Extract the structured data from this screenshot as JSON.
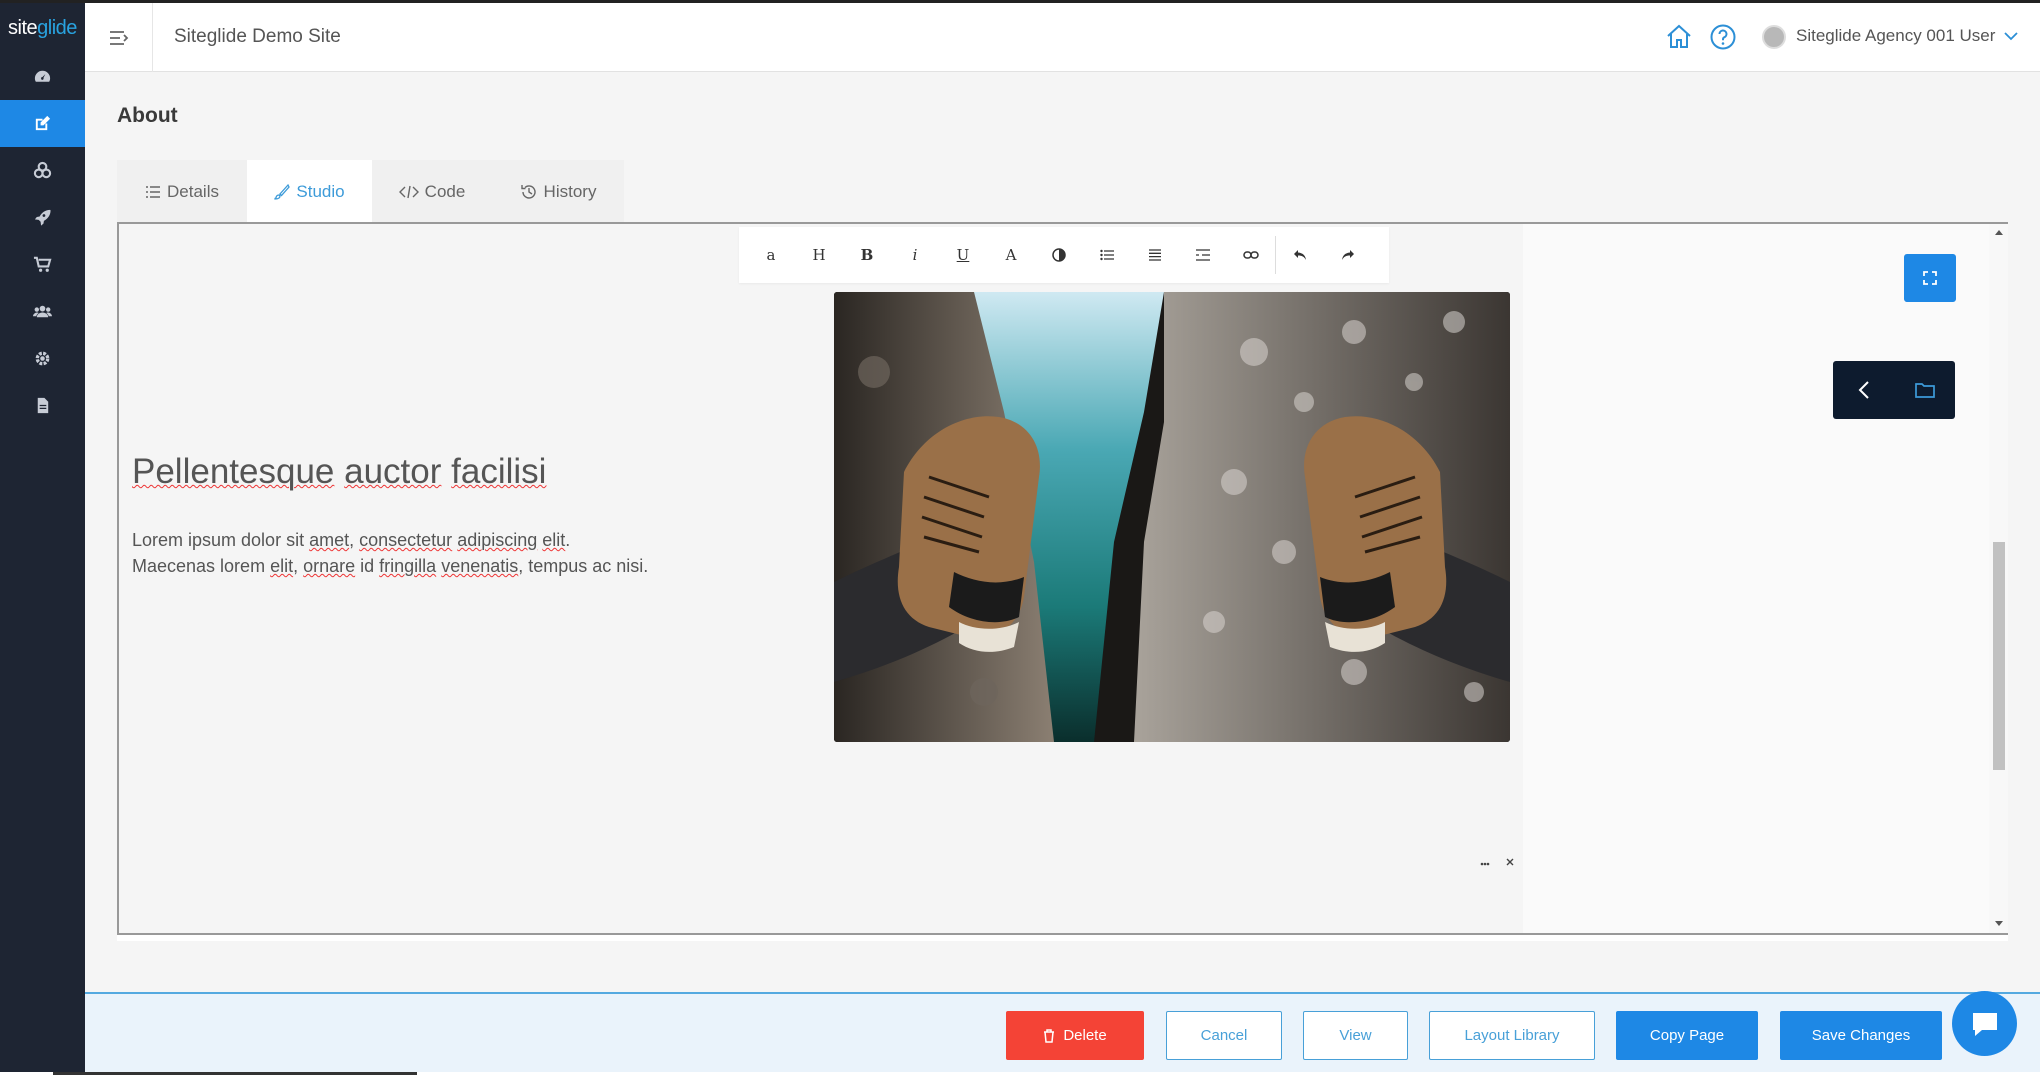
{
  "app": {
    "logo_text_1": "site",
    "logo_text_2": "glide",
    "site_title": "Siteglide Demo Site",
    "user_name": "Siteglide Agency 001 User"
  },
  "sidebar": {
    "items": [
      {
        "icon": "dashboard-icon",
        "active": false
      },
      {
        "icon": "edit-icon",
        "active": true
      },
      {
        "icon": "modules-icon",
        "active": false
      },
      {
        "icon": "rocket-icon",
        "active": false
      },
      {
        "icon": "cart-icon",
        "active": false
      },
      {
        "icon": "users-icon",
        "active": false
      },
      {
        "icon": "gear-icon",
        "active": false
      },
      {
        "icon": "document-icon",
        "active": false
      }
    ]
  },
  "page": {
    "title": "About"
  },
  "tabs": [
    {
      "label": "Details",
      "icon": "list-icon"
    },
    {
      "label": "Studio",
      "icon": "brush-icon",
      "active": true
    },
    {
      "label": "Code",
      "icon": "code-icon"
    },
    {
      "label": "History",
      "icon": "history-icon"
    }
  ],
  "toolbar": {
    "buttons": [
      "a",
      "H",
      "B",
      "i",
      "U",
      "A"
    ]
  },
  "content": {
    "heading_words": [
      "Pellentesque",
      "auctor",
      "facilisi"
    ],
    "para_line1_prefix": "Lorem ipsum dolor sit ",
    "para_amet": "amet",
    "para_comma1": ", ",
    "para_consectetur": "consectetur",
    "para_space1": " ",
    "para_adipiscing": "adipiscing",
    "para_space2": " ",
    "para_elit1": "elit",
    "para_period": ".",
    "para_line2_prefix": "Maecenas lorem ",
    "para_elit2": "elit",
    "para_comma2": ", ",
    "para_ornare": "ornare",
    "para_id": " id ",
    "para_fringilla": "fringilla",
    "para_space3": " ",
    "para_venenatis": "venenatis",
    "para_suffix": ", tempus ac nisi."
  },
  "footer": {
    "delete": "Delete",
    "cancel": "Cancel",
    "view": "View",
    "layout_library": "Layout Library",
    "copy_page": "Copy Page",
    "save_changes": "Save Changes"
  },
  "colors": {
    "accent": "#1e88e5",
    "sidebar": "#1e2533",
    "danger": "#f44336"
  }
}
